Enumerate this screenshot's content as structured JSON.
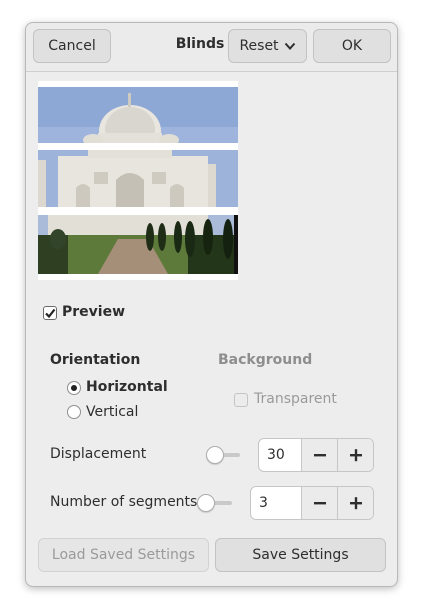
{
  "header": {
    "cancel_label": "Cancel",
    "title": "Blinds",
    "reset_label": "Reset",
    "ok_label": "OK"
  },
  "preview": {
    "label": "Preview",
    "checked": true
  },
  "orientation": {
    "heading": "Orientation",
    "options": [
      "Horizontal",
      "Vertical"
    ],
    "selected": "Horizontal"
  },
  "background": {
    "heading": "Background",
    "transparent_label": "Transparent",
    "transparent_checked": false
  },
  "displacement": {
    "label": "Displacement",
    "value": "30",
    "slider_fraction": 0.3
  },
  "segments": {
    "label": "Number of segments",
    "value": "3",
    "slider_fraction": 0.03
  },
  "footer": {
    "load_label": "Load Saved Settings",
    "save_label": "Save Settings"
  },
  "colors": {
    "accent": "#3584e4",
    "dialog_bg": "#ededed"
  },
  "icons": {
    "reset_dropdown": "chevron-down-icon",
    "decrement": "minus-icon",
    "increment": "plus-icon"
  }
}
